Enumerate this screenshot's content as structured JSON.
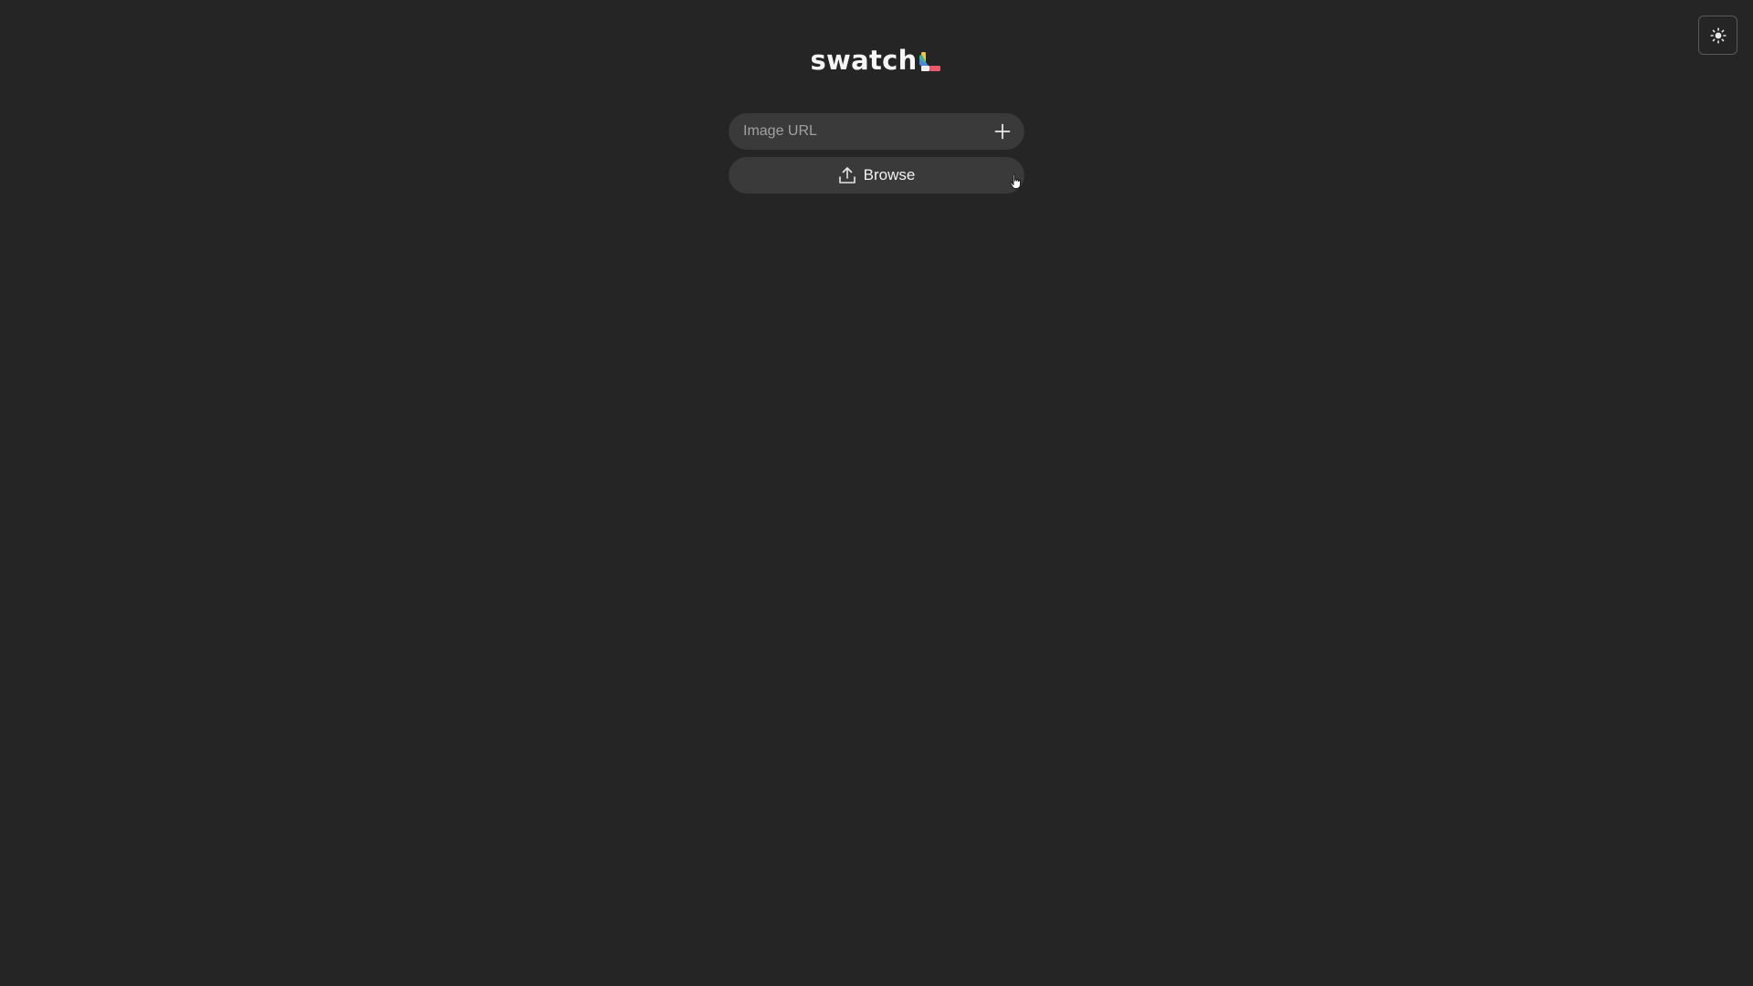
{
  "app": {
    "title": "swatch"
  },
  "theme_toggle": {
    "icon": "sun-icon"
  },
  "url_input": {
    "placeholder": "Image URL",
    "value": ""
  },
  "add_button": {
    "icon": "plus-icon"
  },
  "browse_button": {
    "label": "Browse",
    "icon": "upload-icon"
  },
  "colors": {
    "background": "#252525",
    "control_background": "#3a3a3a",
    "text": "#f2f2f2",
    "placeholder": "#a0a0a0",
    "logo_accents": [
      "#f3c445",
      "#3fb3a0",
      "#4f86d9",
      "#e8596a",
      "#e98f3c"
    ]
  }
}
